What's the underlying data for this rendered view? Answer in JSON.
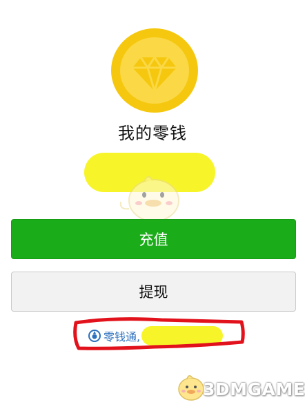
{
  "wallet": {
    "title": "我的零钱",
    "amount": ""
  },
  "actions": {
    "recharge_label": "充值",
    "withdraw_label": "提现"
  },
  "lingqiantong": {
    "label": "零钱通,"
  },
  "watermark": {
    "text": "3DMGAME"
  },
  "colors": {
    "coin": "#f5c80f",
    "recharge_bg": "#1aad19",
    "withdraw_bg": "#f2f2f2",
    "link": "#2b6fbd",
    "redaction": "#f7f52a",
    "annotation": "#e2121c"
  },
  "icons": {
    "coin": "diamond-coin-icon",
    "lingqiantong": "lingqiantong-icon"
  }
}
